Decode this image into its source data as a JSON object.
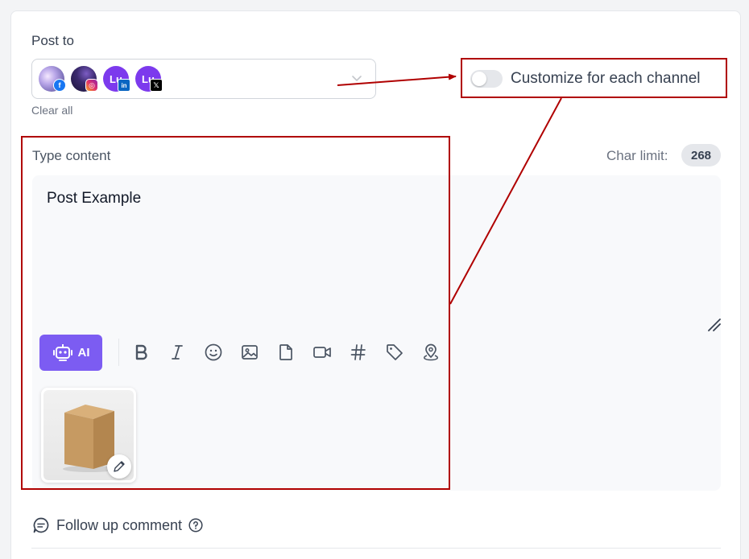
{
  "post_to": {
    "label": "Post to",
    "clear_all": "Clear all",
    "channels": [
      {
        "network": "facebook",
        "badge_icon": "facebook-icon",
        "badge_text": "f"
      },
      {
        "network": "instagram",
        "badge_icon": "instagram-icon",
        "badge_text": "◎"
      },
      {
        "network": "linkedin",
        "initials": "Lu",
        "badge_icon": "linkedin-icon",
        "badge_text": "in"
      },
      {
        "network": "x",
        "initials": "Lu",
        "badge_icon": "x-icon",
        "badge_text": "𝕏"
      }
    ]
  },
  "customize": {
    "label": "Customize for each channel",
    "enabled": false
  },
  "editor": {
    "type_content_label": "Type content",
    "char_limit_label": "Char limit:",
    "char_limit_value": "268",
    "content": "Post Example",
    "ai_label": "AI",
    "toolbar": [
      "bold-icon",
      "italic-icon",
      "emoji-icon",
      "image-icon",
      "file-icon",
      "video-icon",
      "hashtag-icon",
      "tag-icon",
      "location-icon"
    ]
  },
  "follow_up": {
    "label": "Follow up comment"
  },
  "colors": {
    "accent": "#7c5cf2",
    "annotation": "#b00000"
  }
}
